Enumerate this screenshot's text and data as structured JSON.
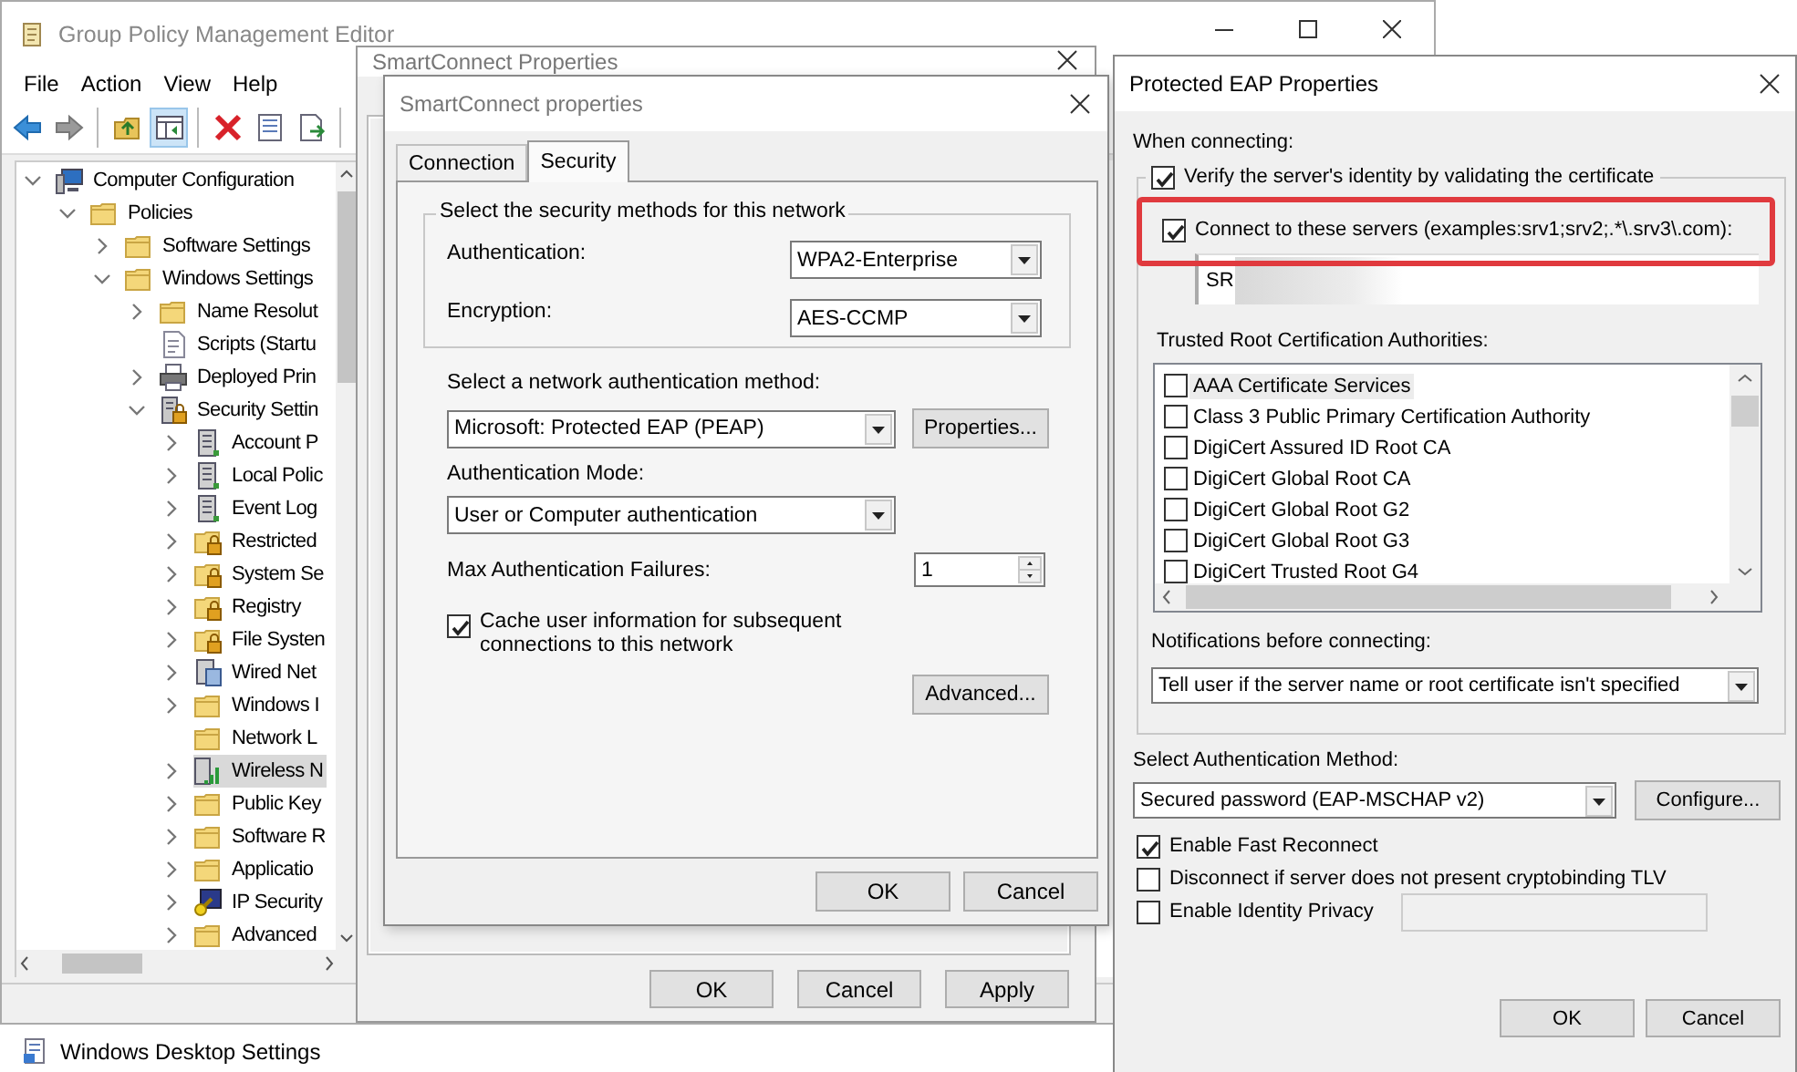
{
  "main_window": {
    "title": "Group Policy Management Editor",
    "menu": [
      "File",
      "Action",
      "View",
      "Help"
    ],
    "toolbar": [
      {
        "kind": "back",
        "pressed": false
      },
      {
        "kind": "forward",
        "pressed": false
      },
      {
        "kind": "separator"
      },
      {
        "kind": "up",
        "pressed": false
      },
      {
        "kind": "pane",
        "pressed": true
      },
      {
        "kind": "separator"
      },
      {
        "kind": "delete",
        "pressed": false
      },
      {
        "kind": "properties",
        "pressed": false
      },
      {
        "kind": "export",
        "pressed": false
      },
      {
        "kind": "separator"
      }
    ],
    "tree": [
      {
        "label": "Computer Configuration",
        "kind": "computer",
        "expanded": true,
        "selected": false,
        "children": [
          {
            "label": "Policies",
            "kind": "folder",
            "expanded": true,
            "selected": false,
            "children": [
              {
                "label": "Software Settings",
                "kind": "folder",
                "expanded": false,
                "selected": false
              },
              {
                "label": "Windows Settings",
                "kind": "folder",
                "expanded": true,
                "selected": false,
                "children": [
                  {
                    "label": "Name Resolut",
                    "kind": "folder",
                    "expanded": false,
                    "selected": false
                  },
                  {
                    "label": "Scripts (Startu",
                    "kind": "script",
                    "selected": false
                  },
                  {
                    "label": "Deployed Prin",
                    "kind": "printer",
                    "expanded": false,
                    "selected": false
                  },
                  {
                    "label": "Security Settin",
                    "kind": "secure-server",
                    "expanded": true,
                    "selected": false,
                    "children": [
                      {
                        "label": "Account P",
                        "kind": "server",
                        "expanded": false,
                        "selected": false
                      },
                      {
                        "label": "Local Polic",
                        "kind": "server",
                        "expanded": false,
                        "selected": false
                      },
                      {
                        "label": "Event Log",
                        "kind": "server",
                        "expanded": false,
                        "selected": false
                      },
                      {
                        "label": "Restricted",
                        "kind": "lock-folder",
                        "expanded": false,
                        "selected": false
                      },
                      {
                        "label": "System Se",
                        "kind": "lock-folder",
                        "expanded": false,
                        "selected": false
                      },
                      {
                        "label": "Registry",
                        "kind": "lock-folder",
                        "expanded": false,
                        "selected": false
                      },
                      {
                        "label": "File Systen",
                        "kind": "lock-folder",
                        "expanded": false,
                        "selected": false
                      },
                      {
                        "label": "Wired Net",
                        "kind": "network",
                        "expanded": false,
                        "selected": false
                      },
                      {
                        "label": "Windows I",
                        "kind": "folder",
                        "expanded": false,
                        "selected": false
                      },
                      {
                        "label": "Network L",
                        "kind": "folder",
                        "selected": false
                      },
                      {
                        "label": "Wireless N",
                        "kind": "wireless",
                        "expanded": false,
                        "selected": true
                      },
                      {
                        "label": "Public Key",
                        "kind": "folder",
                        "expanded": false,
                        "selected": false
                      },
                      {
                        "label": "Software R",
                        "kind": "folder",
                        "expanded": false,
                        "selected": false
                      },
                      {
                        "label": "Applicatio",
                        "kind": "folder",
                        "expanded": false,
                        "selected": false
                      },
                      {
                        "label": "IP Security",
                        "kind": "ipsec",
                        "expanded": false,
                        "selected": false
                      },
                      {
                        "label": "Advanced",
                        "kind": "folder",
                        "expanded": false,
                        "selected": false
                      }
                    ]
                  }
                ]
              }
            ]
          }
        ]
      }
    ]
  },
  "background_item": {
    "label": "Windows Desktop Settings"
  },
  "back_dialog": {
    "title": "SmartConnect Properties",
    "buttons": [
      "OK",
      "Cancel",
      "Apply"
    ]
  },
  "network_dialog": {
    "title": "SmartConnect properties",
    "tabs": [
      {
        "label": "Connection",
        "selected": false
      },
      {
        "label": "Security",
        "selected": true
      }
    ],
    "security_group": {
      "legend": "Select the security methods for this network",
      "authentication_label": "Authentication:",
      "authentication": "WPA2-Enterprise",
      "encryption_label": "Encryption:",
      "encryption": "AES-CCMP"
    },
    "method_label": "Select a network authentication method:",
    "method": "Microsoft: Protected EAP (PEAP)",
    "properties_button": "Properties...",
    "mode_label": "Authentication Mode:",
    "mode": "User or Computer authentication",
    "max_failures_label": "Max Authentication Failures:",
    "max_failures": "1",
    "cache": {
      "label": "Cache user information for subsequent connections to this network",
      "checked": true
    },
    "advanced_button": "Advanced...",
    "buttons": [
      "OK",
      "Cancel"
    ]
  },
  "peap_dialog": {
    "title": "Protected EAP Properties",
    "when_label": "When connecting:",
    "verify": {
      "label": "Verify the server's identity by validating the certificate",
      "checked": true
    },
    "connect_servers": {
      "label": "Connect to these servers (examples:srv1;srv2;.*\\.srv3\\.com):",
      "checked": true,
      "highlighted": true
    },
    "servers_field": {
      "value": "SR",
      "redacted": true
    },
    "ca_label": "Trusted Root Certification Authorities:",
    "ca_list": [
      {
        "label": "AAA Certificate Services",
        "checked": false,
        "selected": true
      },
      {
        "label": "Class 3 Public Primary Certification Authority",
        "checked": false,
        "selected": false
      },
      {
        "label": "DigiCert Assured ID Root CA",
        "checked": false,
        "selected": false
      },
      {
        "label": "DigiCert Global Root CA",
        "checked": false,
        "selected": false
      },
      {
        "label": "DigiCert Global Root G2",
        "checked": false,
        "selected": false
      },
      {
        "label": "DigiCert Global Root G3",
        "checked": false,
        "selected": false
      },
      {
        "label": "DigiCert Trusted Root G4",
        "checked": false,
        "selected": false
      }
    ],
    "notifications_label": "Notifications before connecting:",
    "notifications": "Tell user if the server name or root certificate isn't specified",
    "method_label": "Select Authentication Method:",
    "method": "Secured password (EAP-MSCHAP v2)",
    "configure_button": "Configure...",
    "options": [
      {
        "label": "Enable Fast Reconnect",
        "checked": true
      },
      {
        "label": "Disconnect if server does not present cryptobinding TLV",
        "checked": false
      },
      {
        "label": "Enable Identity Privacy",
        "checked": false,
        "has_field": true
      }
    ],
    "buttons": [
      "OK",
      "Cancel"
    ]
  }
}
